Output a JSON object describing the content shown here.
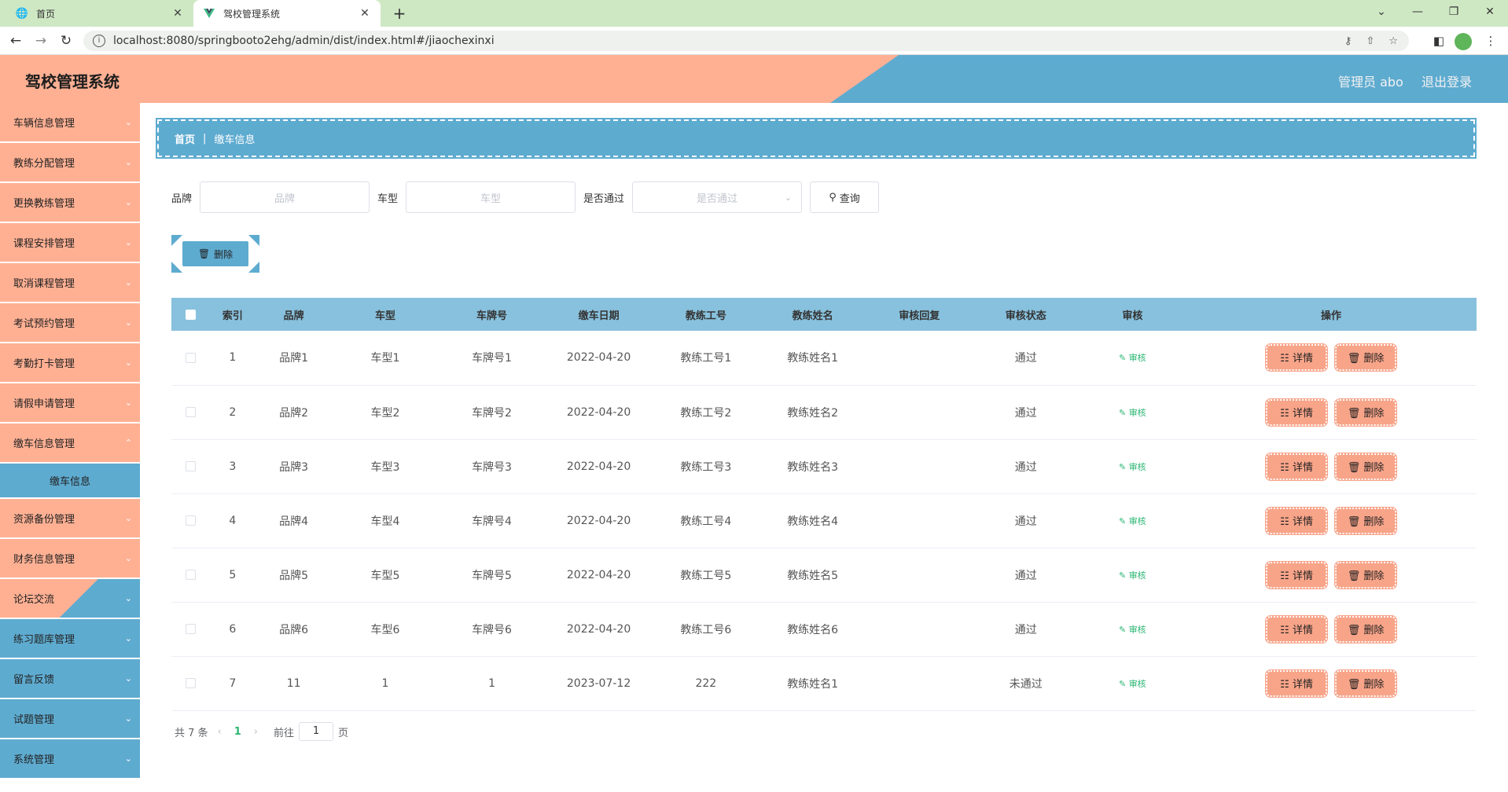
{
  "browser": {
    "tabs": [
      {
        "title": "首页",
        "active": false
      },
      {
        "title": "驾校管理系统",
        "active": true
      }
    ],
    "url": "localhost:8080/springbooto2ehg/admin/dist/index.html#/jiaochexinxi"
  },
  "header": {
    "title": "驾校管理系统",
    "user": "管理员 abo",
    "logout": "退出登录"
  },
  "sidebar": {
    "items": [
      {
        "label": "车辆信息管理"
      },
      {
        "label": "教练分配管理"
      },
      {
        "label": "更换教练管理"
      },
      {
        "label": "课程安排管理"
      },
      {
        "label": "取消课程管理"
      },
      {
        "label": "考试预约管理"
      },
      {
        "label": "考勤打卡管理"
      },
      {
        "label": "请假申请管理"
      },
      {
        "label": "缴车信息管理"
      },
      {
        "label": "资源备份管理"
      },
      {
        "label": "财务信息管理"
      },
      {
        "label": "论坛交流"
      },
      {
        "label": "练习题库管理"
      },
      {
        "label": "留言反馈"
      },
      {
        "label": "试题管理"
      },
      {
        "label": "系统管理"
      }
    ],
    "active_sub": "缴车信息"
  },
  "breadcrumb": {
    "home": "首页",
    "current": "缴车信息"
  },
  "filter": {
    "brand_label": "品牌",
    "brand_placeholder": "品牌",
    "model_label": "车型",
    "model_placeholder": "车型",
    "pass_label": "是否通过",
    "pass_placeholder": "是否通过",
    "query_label": "查询"
  },
  "toolbar": {
    "delete_label": "删除"
  },
  "table": {
    "headers": [
      "索引",
      "品牌",
      "车型",
      "车牌号",
      "缴车日期",
      "教练工号",
      "教练姓名",
      "审核回复",
      "审核状态",
      "审核",
      "操作"
    ],
    "audit_label": "审核",
    "detail_label": "详情",
    "delete_label": "删除",
    "rows": [
      {
        "idx": "1",
        "brand": "品牌1",
        "model": "车型1",
        "plate": "车牌号1",
        "date": "2022-04-20",
        "coach_id": "教练工号1",
        "coach_name": "教练姓名1",
        "reply": "",
        "status": "通过"
      },
      {
        "idx": "2",
        "brand": "品牌2",
        "model": "车型2",
        "plate": "车牌号2",
        "date": "2022-04-20",
        "coach_id": "教练工号2",
        "coach_name": "教练姓名2",
        "reply": "",
        "status": "通过"
      },
      {
        "idx": "3",
        "brand": "品牌3",
        "model": "车型3",
        "plate": "车牌号3",
        "date": "2022-04-20",
        "coach_id": "教练工号3",
        "coach_name": "教练姓名3",
        "reply": "",
        "status": "通过"
      },
      {
        "idx": "4",
        "brand": "品牌4",
        "model": "车型4",
        "plate": "车牌号4",
        "date": "2022-04-20",
        "coach_id": "教练工号4",
        "coach_name": "教练姓名4",
        "reply": "",
        "status": "通过"
      },
      {
        "idx": "5",
        "brand": "品牌5",
        "model": "车型5",
        "plate": "车牌号5",
        "date": "2022-04-20",
        "coach_id": "教练工号5",
        "coach_name": "教练姓名5",
        "reply": "",
        "status": "通过"
      },
      {
        "idx": "6",
        "brand": "品牌6",
        "model": "车型6",
        "plate": "车牌号6",
        "date": "2022-04-20",
        "coach_id": "教练工号6",
        "coach_name": "教练姓名6",
        "reply": "",
        "status": "通过"
      },
      {
        "idx": "7",
        "brand": "11",
        "model": "1",
        "plate": "1",
        "date": "2023-07-12",
        "coach_id": "222",
        "coach_name": "教练姓名1",
        "reply": "",
        "status": "未通过"
      }
    ]
  },
  "pager": {
    "total": "共 7 条",
    "current": "1",
    "goto_label": "前往",
    "goto_value": "1",
    "page_label": "页"
  },
  "colors": {
    "salmon": "#ffb093",
    "blue": "#5eabd0",
    "header_blue": "#88c1dd",
    "green": "#2bb673"
  }
}
